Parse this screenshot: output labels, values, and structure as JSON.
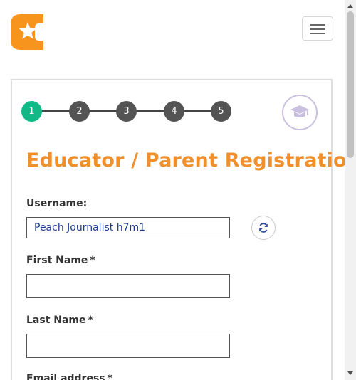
{
  "header": {
    "logo_icon": "star-c-logo-icon",
    "menu_icon": "hamburger-menu-icon"
  },
  "stepper": {
    "steps": [
      "1",
      "2",
      "3",
      "4",
      "5"
    ],
    "active_step": 1,
    "active_color": "#12b886",
    "inactive_color": "#545454",
    "badge_icon": "graduation-cap-icon"
  },
  "form": {
    "title": "Educator / Parent Registration",
    "title_color": "#f0902d",
    "username_label": "Username:",
    "username_value": "Peach Journalist h7m1",
    "refresh_icon": "refresh-icon",
    "first_name_label": "First Name",
    "last_name_label": "Last Name",
    "email_label": "Email address",
    "required_marker": "*",
    "first_name_value": "",
    "last_name_value": ""
  },
  "brand_color": "#f7941d"
}
